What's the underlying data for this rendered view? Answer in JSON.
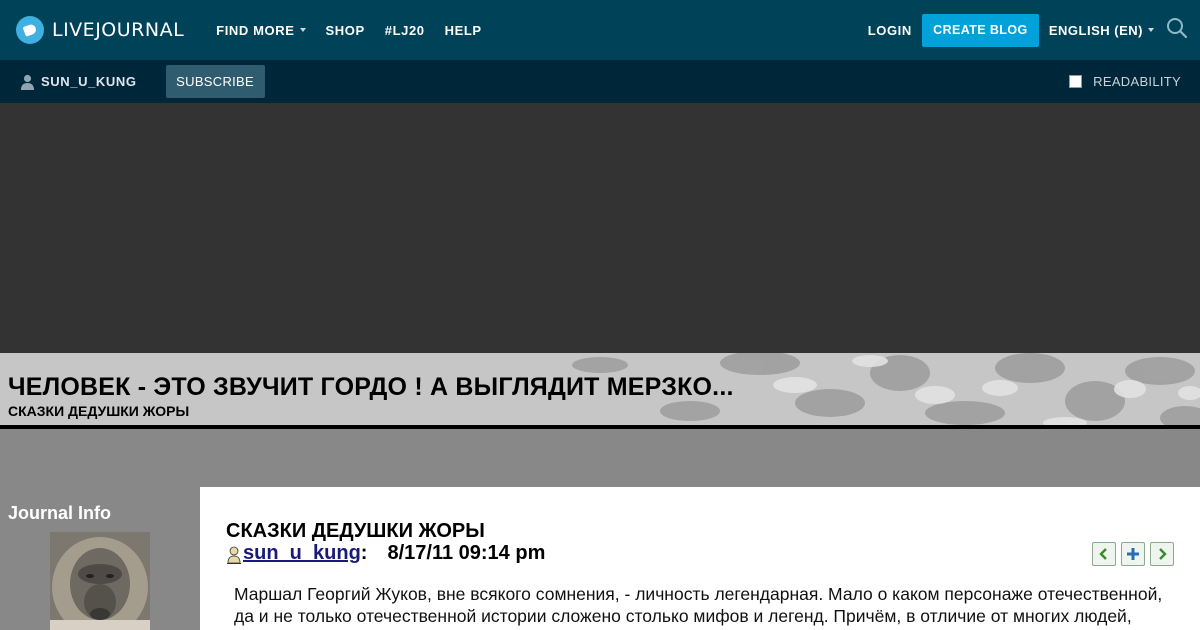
{
  "topbar": {
    "logo_text": "LIVEJOURNAL",
    "nav": [
      "FIND MORE",
      "SHOP",
      "#LJ20",
      "HELP"
    ],
    "login": "LOGIN",
    "create_blog": "CREATE BLOG",
    "language": "ENGLISH (EN)",
    "colors": {
      "bar": "#004359",
      "accent": "#00a2d9"
    }
  },
  "subbar": {
    "username": "SUN_U_KUNG",
    "subscribe": "SUBSCRIBE",
    "readability": "READABILITY",
    "readability_checked": false
  },
  "journal": {
    "title": "ЧЕЛОВЕК - ЭТО ЗВУЧИТ ГОРДО ! А ВЫГЛЯДИТ МЕРЗКО...",
    "subtitle": "СКАЗКИ ДЕДУШКИ ЖОРЫ"
  },
  "sidebar": {
    "heading": "Journal Info"
  },
  "post": {
    "title": "СКАЗКИ ДЕДУШКИ ЖОРЫ",
    "author": "sun_u_kung",
    "separator": ":",
    "datetime": "8/17/11 09:14 pm",
    "body": "Маршал Георгий Жуков, вне всякого сомнения, - личность легендарная. Мало о каком персонаже отечественной, да и не только отечественной истории сложено столько мифов и легенд. Причём, в отличие от многих людей, Жуков сам весьма активно поучаствовал в мифотворчестве о самом себе. Об этом"
  }
}
